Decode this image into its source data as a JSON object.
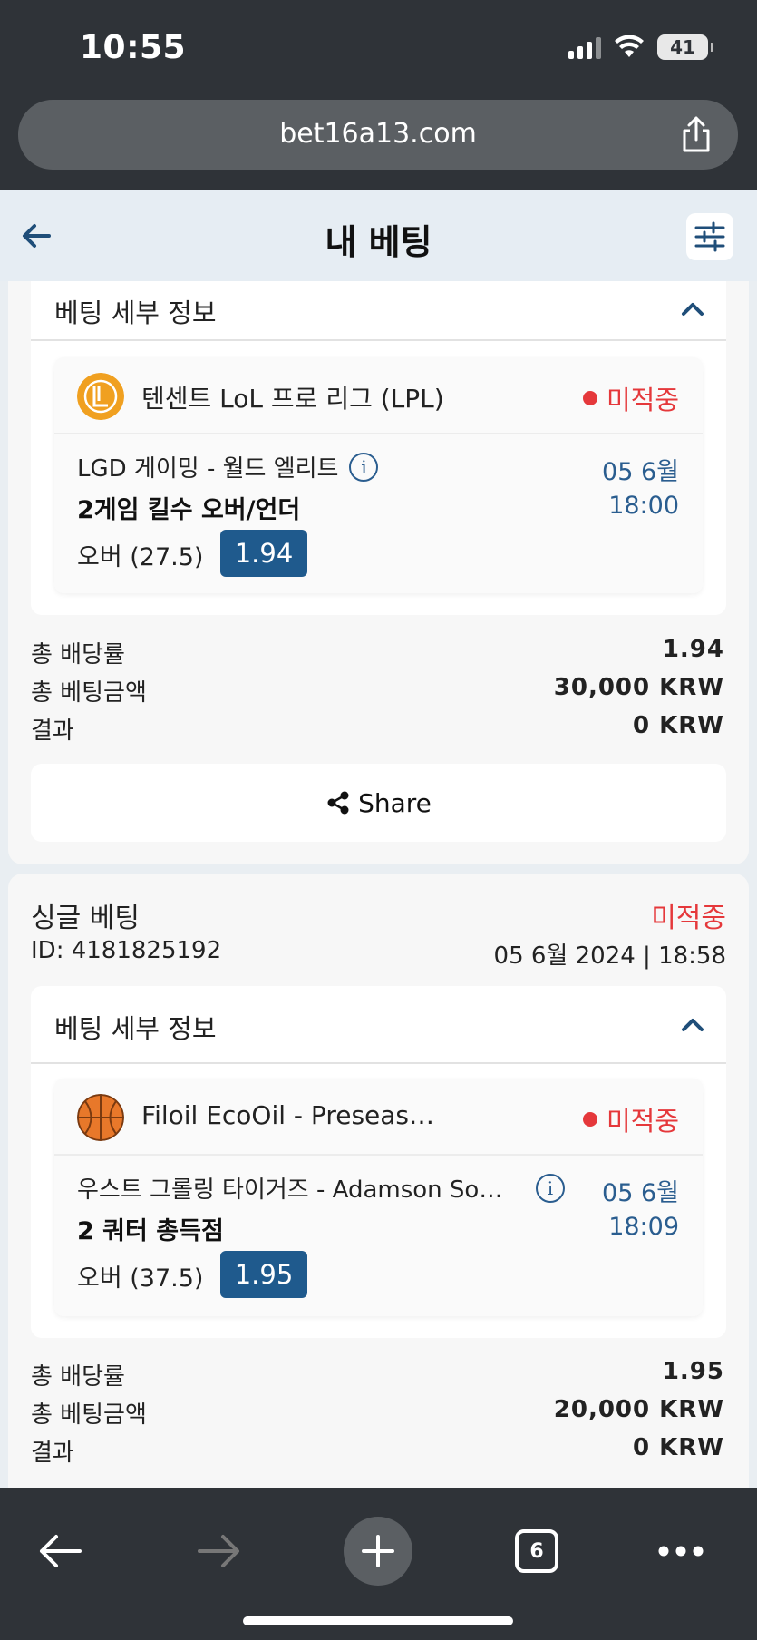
{
  "status_bar": {
    "time": "10:55",
    "battery": "41"
  },
  "browser": {
    "url": "bet16a13.com",
    "tabs_count": "6"
  },
  "header": {
    "title": "내 베팅"
  },
  "bets": [
    {
      "details_title": "베팅 세부 정보",
      "league": "텐센트 LoL 프로 리그 (LPL)",
      "league_icon": "lol-league-icon",
      "status": "미적중",
      "match": "LGD 게이밍 - 월드 엘리트",
      "date": "05 6월",
      "time": "18:00",
      "market": "2게임 킬수 오버/언더",
      "selection": "오버 (27.5)",
      "odds": "1.94",
      "summary": [
        {
          "label": "총 배당률",
          "value": "1.94"
        },
        {
          "label": "총 베팅금액",
          "value": "30,000 KRW"
        },
        {
          "label": "결과",
          "value": "0 KRW"
        }
      ],
      "share_label": "Share"
    },
    {
      "type": "싱글 베팅",
      "status_header": "미적중",
      "id_text": "ID: 4181825192",
      "placed": "05 6월 2024 | 18:58",
      "details_title": "베팅 세부 정보",
      "league": "Filoil EcoOil - Preseason Cup",
      "league_icon": "basketball-icon",
      "status": "미적중",
      "match": "우스트 그롤링 타이거즈 - Adamson Soaring Falcons",
      "date": "05 6월",
      "time": "18:09",
      "market": "2 쿼터 총득점",
      "selection": "오버 (37.5)",
      "odds": "1.95",
      "summary": [
        {
          "label": "총 배당률",
          "value": "1.95"
        },
        {
          "label": "총 베팅금액",
          "value": "20,000 KRW"
        },
        {
          "label": "결과",
          "value": "0 KRW"
        }
      ]
    }
  ],
  "colors": {
    "accent": "#1f5a8d",
    "lost": "#e5383b",
    "chrome": "#2f3338"
  }
}
